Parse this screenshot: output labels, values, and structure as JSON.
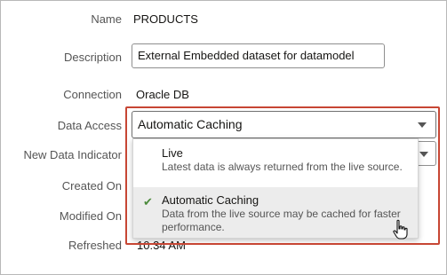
{
  "form": {
    "name_label": "Name",
    "name_value": "PRODUCTS",
    "description_label": "Description",
    "description_value": "External Embedded dataset for datamodel",
    "connection_label": "Connection",
    "connection_value": "Oracle DB",
    "data_access_label": "Data Access",
    "data_access_value": "Automatic Caching",
    "new_data_indicator_label": "New Data Indicator",
    "created_on_label": "Created On",
    "modified_on_label": "Modified On",
    "refreshed_label": "Refreshed",
    "refreshed_value": "10:34 AM"
  },
  "dropdown": {
    "options": [
      {
        "title": "Live",
        "description": "Latest data is always returned from the live source.",
        "selected": false
      },
      {
        "title": "Automatic Caching",
        "description_line1": "Data from the live source may be cached for faster",
        "description_line2": "performance.",
        "selected": true
      }
    ]
  },
  "icons": {
    "selected_check": "check-icon",
    "dropdown_arrow": "chevron-down-icon",
    "cursor": "hand-pointer-icon"
  },
  "colors": {
    "highlight_border": "#c74634",
    "check": "#4b8a3b",
    "selected_option_bg": "#ececec"
  }
}
